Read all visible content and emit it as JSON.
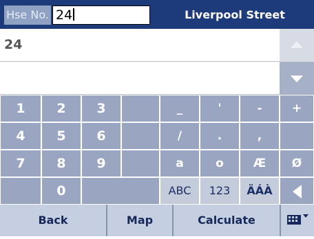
{
  "header": {
    "field_label": "Hse No.",
    "house_number_value": "24",
    "street_name": "Liverpool Street"
  },
  "results": [
    {
      "text": "24"
    },
    {
      "text": ""
    }
  ],
  "scroll": {
    "up_icon": "arrow-up-icon",
    "down_icon": "arrow-down-icon"
  },
  "keypad": {
    "rows": [
      [
        "1",
        "2",
        "3",
        "",
        "_",
        "'",
        "-",
        "+"
      ],
      [
        "4",
        "5",
        "6",
        "",
        "/",
        ".",
        ",",
        ""
      ],
      [
        "7",
        "8",
        "9",
        "",
        "a",
        "o",
        "Æ",
        "Ø"
      ],
      [
        "",
        "0",
        "",
        "ABC",
        "123",
        "ÄÁÀ",
        "backspace"
      ]
    ]
  },
  "bottom_bar": {
    "back_label": "Back",
    "map_label": "Map",
    "calculate_label": "Calculate",
    "menu_icon": "keyboard-menu-icon"
  },
  "colors": {
    "header_bg": "#1d3a7a",
    "key_bg": "#9aa6c1",
    "key_light_bg": "#c4cbdb",
    "bottom_bg": "#c6cfe2"
  }
}
